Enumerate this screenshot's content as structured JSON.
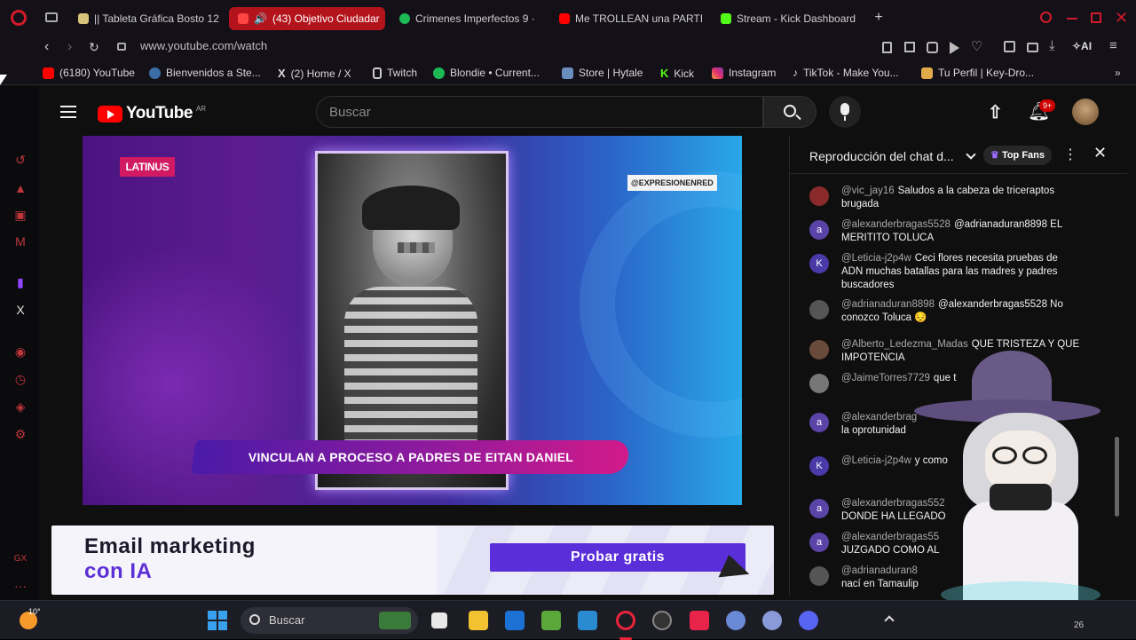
{
  "browser": {
    "tabs": [
      {
        "label": "|| Tableta Gráfica Bosto 12",
        "active": false,
        "color": "#d7c47a"
      },
      {
        "label": "(43) Objetivo Ciudadar",
        "active": true,
        "color": "#ff0000"
      },
      {
        "label": "Crimenes Imperfectos 9 ·",
        "active": false,
        "color": "#1db954"
      },
      {
        "label": "Me TROLLEAN una PARTI",
        "active": false,
        "color": "#ff0000"
      },
      {
        "label": "Stream - Kick Dashboard",
        "active": false,
        "color": "#53fc18"
      }
    ],
    "url": "www.youtube.com/watch",
    "bookmarks": [
      {
        "label": "(6180) YouTube",
        "color": "#ff0000"
      },
      {
        "label": "Bienvenidos a Ste...",
        "color": "#1b2838"
      },
      {
        "label": "(2) Home / X",
        "color": "#ffffff"
      },
      {
        "label": "Twitch",
        "color": "#9146ff"
      },
      {
        "label": "Blondie • Current...",
        "color": "#1db954"
      },
      {
        "label": "Store | Hytale",
        "color": "#6a8fbf"
      },
      {
        "label": "Kick",
        "color": "#53fc18"
      },
      {
        "label": "Instagram",
        "color": "#e1306c"
      },
      {
        "label": "TikTok - Make You...",
        "color": "#ffffff"
      },
      {
        "label": "Tu Perfil | Key-Dro...",
        "color": "#e0a94a"
      }
    ]
  },
  "youtube": {
    "logo_text": "YouTube",
    "country_code": "AR",
    "search_placeholder": "Buscar",
    "notification_badge": "9+",
    "video": {
      "brand": "LATINUS",
      "handle": "@EXPRESIONENRED",
      "headline": "VINCULAN A PROCESO A PADRES DE EITAN DANIEL"
    },
    "ad": {
      "title": "Email marketing",
      "subtitle": "con IA",
      "cta": "Probar gratis"
    }
  },
  "chat": {
    "title": "Reproducción del chat d...",
    "top_fans_label": "Top Fans",
    "messages": [
      {
        "user": "@vic_jay16",
        "text": "Saludos a la cabeza de triceraptos brugada",
        "avatar": "",
        "avatar_color": "#8a2a2a"
      },
      {
        "user": "@alexanderbragas5528",
        "text": "@adrianaduran8898 EL MERITITO TOLUCA",
        "avatar": "a",
        "avatar_color": "#5a44a8"
      },
      {
        "user": "@Leticia-j2p4w",
        "text": "Ceci flores necesita pruebas de ADN muchas batallas para las madres y padres buscadores",
        "avatar": "K",
        "avatar_color": "#4a3aa8"
      },
      {
        "user": "@adrianaduran8898",
        "text": "@alexanderbragas5528 No conozco Toluca 😔",
        "avatar": "",
        "avatar_color": "#555555"
      },
      {
        "user": "@Alberto_Ledezma_Madas",
        "text": "QUE TRISTEZA Y QUE IMPOTENCIA",
        "avatar": "",
        "avatar_color": "#6a4a3a"
      },
      {
        "user": "@JaimeTorres7729",
        "text": "que t",
        "avatar": "",
        "avatar_color": "#777777"
      },
      {
        "user": "@alexanderbrag",
        "text": "la oprotunidad",
        "avatar": "a",
        "avatar_color": "#5a44a8"
      },
      {
        "user": "@Leticia-j2p4w",
        "text": "y como",
        "avatar": "K",
        "avatar_color": "#4a3aa8"
      },
      {
        "user": "@alexanderbragas552",
        "text": "DONDE HA LLEGADO",
        "avatar": "a",
        "avatar_color": "#5a44a8"
      },
      {
        "user": "@alexanderbragas55",
        "text": "JUZGADO COMO AL",
        "avatar": "a",
        "avatar_color": "#5a44a8"
      },
      {
        "user": "@adrianaduran8",
        "text": "nací en Tamaulip",
        "avatar": "",
        "avatar_color": "#555555"
      }
    ]
  },
  "taskbar": {
    "weather_temp": "10°",
    "search_label": "Buscar",
    "clock": "26"
  }
}
